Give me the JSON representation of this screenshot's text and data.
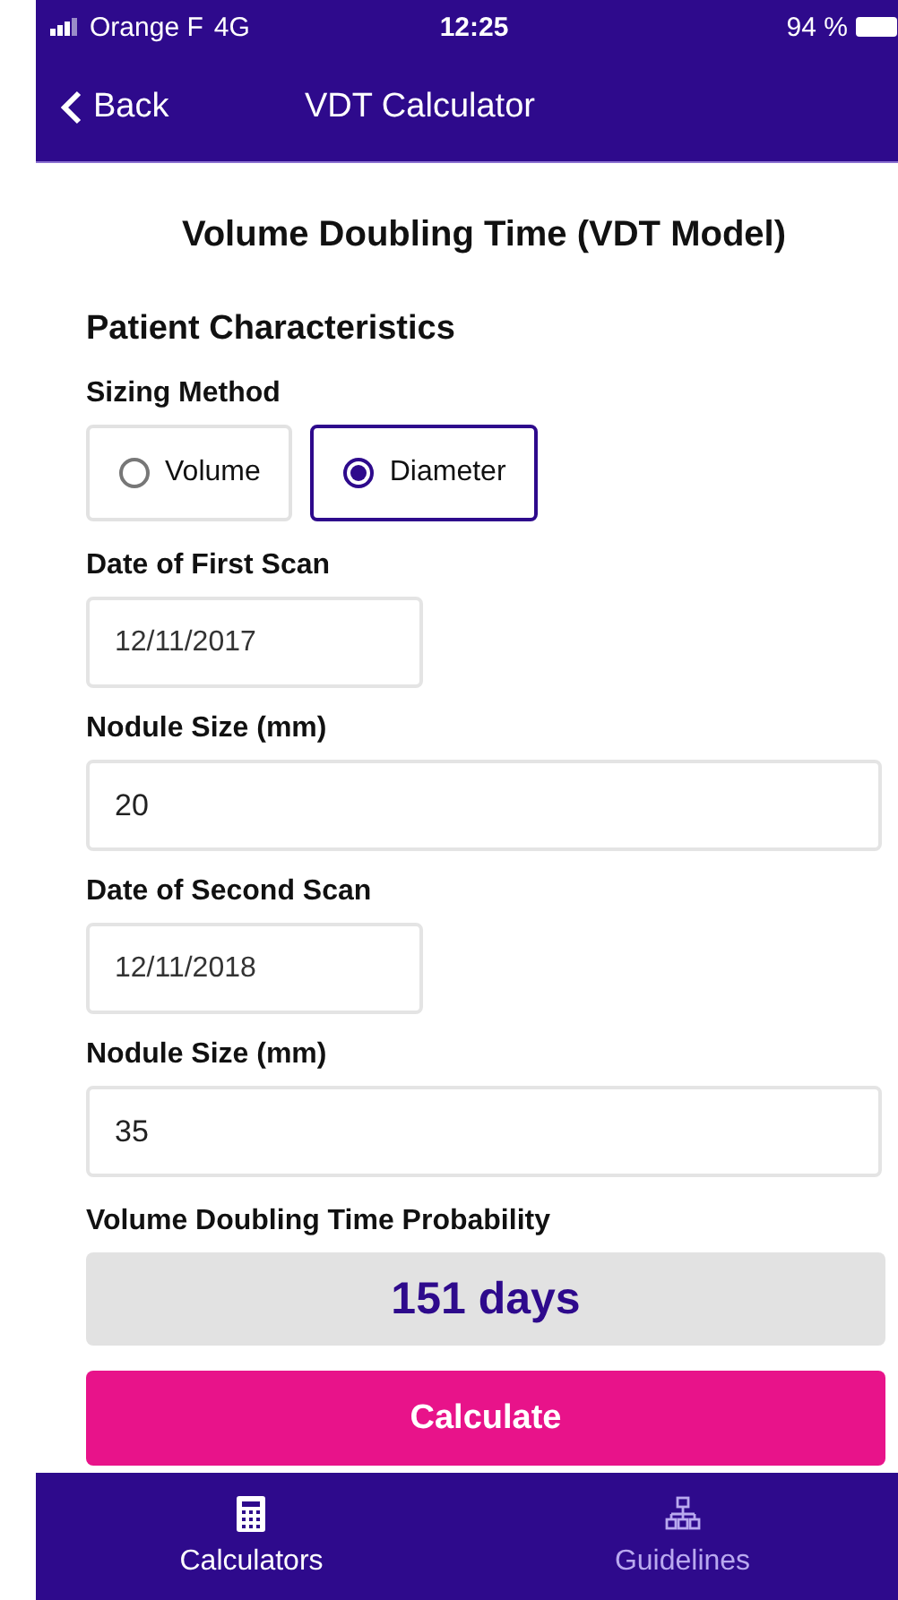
{
  "status_bar": {
    "carrier": "Orange F",
    "network": "4G",
    "time": "12:25",
    "battery": "94 %"
  },
  "nav": {
    "back": "Back",
    "title": "VDT Calculator"
  },
  "heading": "Volume Doubling Time (VDT Model)",
  "section": "Patient Characteristics",
  "sizing": {
    "label": "Sizing Method",
    "options": [
      {
        "label": "Volume",
        "selected": false
      },
      {
        "label": "Diameter",
        "selected": true
      }
    ]
  },
  "fields": [
    {
      "label": "Date of First Scan",
      "value": "12/11/2017",
      "kind": "date"
    },
    {
      "label": "Nodule Size (mm)",
      "value": "20",
      "kind": "number"
    },
    {
      "label": "Date of Second Scan",
      "value": "12/11/2018",
      "kind": "date"
    },
    {
      "label": "Nodule Size (mm)",
      "value": "35",
      "kind": "number"
    }
  ],
  "result": {
    "label": "Volume Doubling Time Probability",
    "value": "151 days"
  },
  "calculate": "Calculate",
  "tabs": [
    {
      "label": "Calculators",
      "selected": true,
      "kind": "calculator"
    },
    {
      "label": "Guidelines",
      "selected": false,
      "kind": "tree"
    }
  ]
}
